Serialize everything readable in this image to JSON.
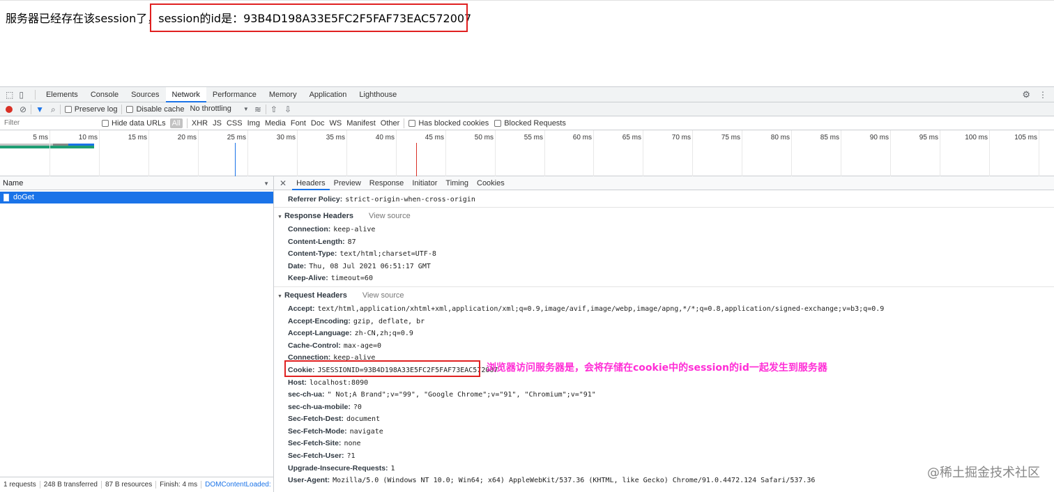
{
  "page": {
    "prefix": "服务器已经存在该session了，",
    "session_text": "session的id是：93B4D198A33E5FC2F5FAF73EAC572007"
  },
  "devtools_tabs": [
    "Elements",
    "Console",
    "Sources",
    "Network",
    "Performance",
    "Memory",
    "Application",
    "Lighthouse"
  ],
  "toolbar": {
    "preserve_log": "Preserve log",
    "disable_cache": "Disable cache",
    "throttling": "No throttling"
  },
  "filterbar": {
    "placeholder": "Filter",
    "hide_data_urls": "Hide data URLs",
    "types": [
      "All",
      "XHR",
      "JS",
      "CSS",
      "Img",
      "Media",
      "Font",
      "Doc",
      "WS",
      "Manifest",
      "Other"
    ],
    "has_blocked_cookies": "Has blocked cookies",
    "blocked_requests": "Blocked Requests"
  },
  "timeline_ticks": [
    "5 ms",
    "10 ms",
    "15 ms",
    "20 ms",
    "25 ms",
    "30 ms",
    "35 ms",
    "40 ms",
    "45 ms",
    "50 ms",
    "55 ms",
    "60 ms",
    "65 ms",
    "70 ms",
    "75 ms",
    "80 ms",
    "85 ms",
    "90 ms",
    "95 ms",
    "100 ms",
    "105 ms"
  ],
  "request_list": {
    "column": "Name",
    "selected": "doGet"
  },
  "summary": [
    "1 requests",
    "248 B transferred",
    "87 B resources",
    "Finish: 4 ms",
    "DOMContentLoaded:"
  ],
  "detail_tabs": [
    "Headers",
    "Preview",
    "Response",
    "Initiator",
    "Timing",
    "Cookies"
  ],
  "referrer": {
    "key": "Referrer Policy:",
    "value": "strict-origin-when-cross-origin"
  },
  "response_headers": {
    "title": "Response Headers",
    "view_source": "View source",
    "items": [
      {
        "k": "Connection:",
        "v": "keep-alive"
      },
      {
        "k": "Content-Length:",
        "v": "87"
      },
      {
        "k": "Content-Type:",
        "v": "text/html;charset=UTF-8"
      },
      {
        "k": "Date:",
        "v": "Thu, 08 Jul 2021 06:51:17 GMT"
      },
      {
        "k": "Keep-Alive:",
        "v": "timeout=60"
      }
    ]
  },
  "request_headers": {
    "title": "Request Headers",
    "view_source": "View source",
    "items": [
      {
        "k": "Accept:",
        "v": "text/html,application/xhtml+xml,application/xml;q=0.9,image/avif,image/webp,image/apng,*/*;q=0.8,application/signed-exchange;v=b3;q=0.9"
      },
      {
        "k": "Accept-Encoding:",
        "v": "gzip, deflate, br"
      },
      {
        "k": "Accept-Language:",
        "v": "zh-CN,zh;q=0.9"
      },
      {
        "k": "Cache-Control:",
        "v": "max-age=0"
      },
      {
        "k": "Connection:",
        "v": "keep-alive"
      },
      {
        "k": "Cookie:",
        "v": "JSESSIONID=93B4D198A33E5FC2F5FAF73EAC572007"
      },
      {
        "k": "Host:",
        "v": "localhost:8090"
      },
      {
        "k": "sec-ch-ua:",
        "v": "\" Not;A Brand\";v=\"99\", \"Google Chrome\";v=\"91\", \"Chromium\";v=\"91\""
      },
      {
        "k": "sec-ch-ua-mobile:",
        "v": "?0"
      },
      {
        "k": "Sec-Fetch-Dest:",
        "v": "document"
      },
      {
        "k": "Sec-Fetch-Mode:",
        "v": "navigate"
      },
      {
        "k": "Sec-Fetch-Site:",
        "v": "none"
      },
      {
        "k": "Sec-Fetch-User:",
        "v": "?1"
      },
      {
        "k": "Upgrade-Insecure-Requests:",
        "v": "1"
      },
      {
        "k": "User-Agent:",
        "v": "Mozilla/5.0 (Windows NT 10.0; Win64; x64) AppleWebKit/537.36 (KHTML, like Gecko) Chrome/91.0.4472.124 Safari/537.36"
      }
    ]
  },
  "annotation": "浏览器访问服务器是，会将存储在cookie中的session的id一起发生到服务器",
  "watermark": "@稀土掘金技术社区",
  "colors": {
    "accent": "#1a73e8",
    "highlight_box": "#e02020",
    "annotation": "#ff2ed6"
  }
}
